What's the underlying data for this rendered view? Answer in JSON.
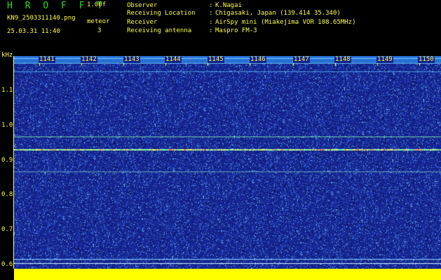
{
  "header": {
    "app_title": "H R O F F T",
    "version": "1.00f",
    "filename": "KN9_2503311140.png",
    "datetime": "25.03.31 11:40",
    "meteor_label": "meteor",
    "meteor_count": "3",
    "info": [
      {
        "label": "Observer",
        "value": "K.Nagai"
      },
      {
        "label": "Receiving Location",
        "value": "Chigasaki, Japan (139.414 35.340)"
      },
      {
        "label": "Receiver",
        "value": "AirSpy mini (Miakejima VOR 108.65MHz)"
      },
      {
        "label": "Receiving antenna",
        "value": "Maspro FM-3"
      }
    ]
  },
  "axis": {
    "unit": "kHz",
    "y_ticks": [
      "1.1",
      "1.0",
      "0.9",
      "0.8",
      "0.7",
      "0.6"
    ],
    "time_ticks": [
      "1141",
      "1142",
      "1143",
      "1144",
      "1145",
      "1146",
      "1147",
      "1148",
      "1149",
      "1150"
    ]
  },
  "colors": {
    "background": "#15228c",
    "text": "#ffff44",
    "title": "#22dd22",
    "trace": "#ffff00"
  }
}
